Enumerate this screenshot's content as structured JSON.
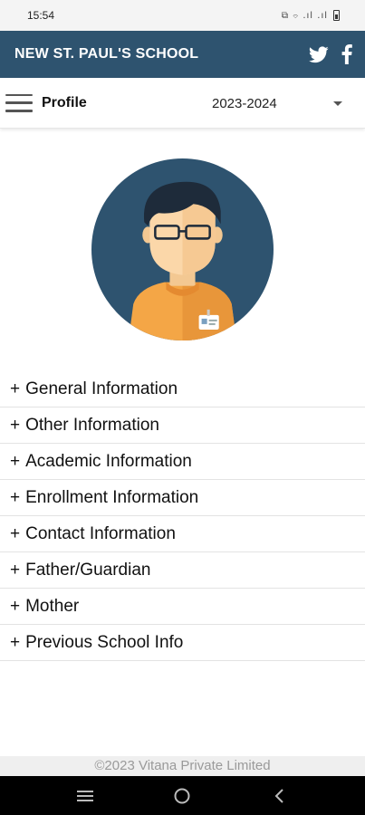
{
  "status_bar": {
    "time": "15:54",
    "indicators": "⧉ ⌔ .ıl .ıl"
  },
  "app_bar": {
    "school_name": "NEW ST. PAUL'S SCHOOL",
    "icons": [
      "twitter-icon",
      "facebook-icon"
    ]
  },
  "toolbar": {
    "title": "Profile",
    "academic_year": "2023-2024"
  },
  "sections": [
    {
      "label": "General Information"
    },
    {
      "label": "Other Information"
    },
    {
      "label": "Academic Information"
    },
    {
      "label": "Enrollment Information"
    },
    {
      "label": "Contact Information"
    },
    {
      "label": "Father/Guardian"
    },
    {
      "label": "Mother"
    },
    {
      "label": "Previous School Info"
    }
  ],
  "section_prefix": "+",
  "footer": {
    "copyright": "©2023 Vitana Private Limited"
  },
  "colors": {
    "app_bar": "#2e536f",
    "avatar_bg": "#2e536f",
    "shirt": "#f4a646",
    "skin": "#fbd7a9",
    "hair": "#1e2b3a"
  }
}
